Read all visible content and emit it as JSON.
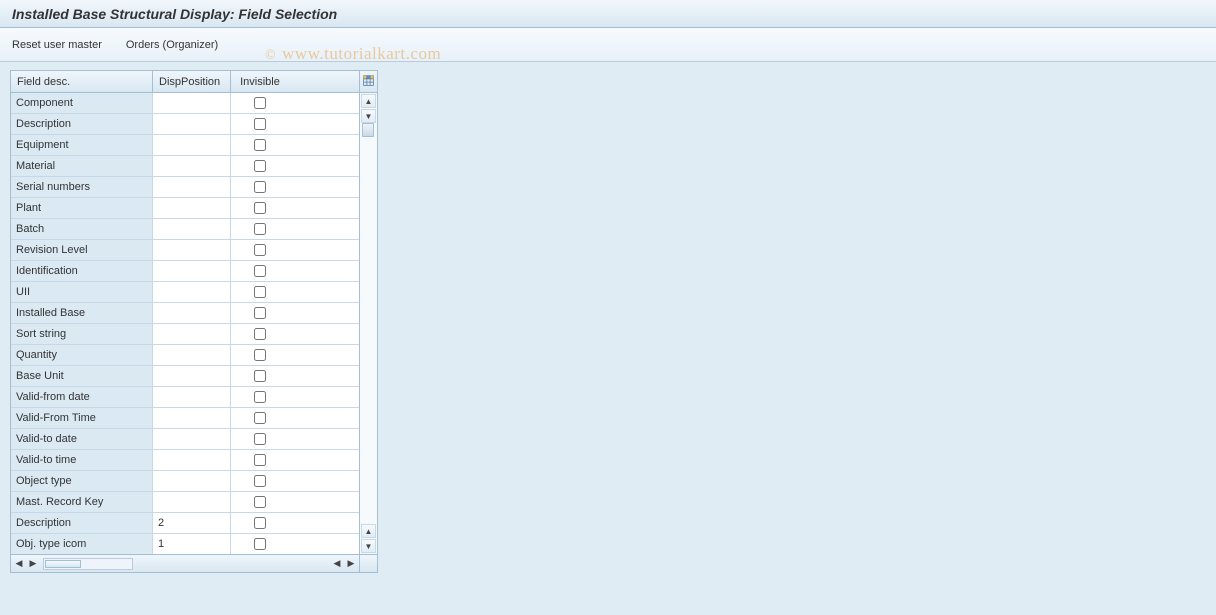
{
  "title": "Installed Base Structural Display: Field Selection",
  "toolbar": {
    "reset": "Reset user master",
    "orders": "Orders (Organizer)"
  },
  "watermark": "www.tutorialkart.com",
  "table": {
    "headers": {
      "desc": "Field desc.",
      "pos": "DispPosition",
      "inv": "Invisible"
    },
    "rows": [
      {
        "desc": "Component",
        "pos": "",
        "inv": false
      },
      {
        "desc": "Description",
        "pos": "",
        "inv": false
      },
      {
        "desc": "Equipment",
        "pos": "",
        "inv": false
      },
      {
        "desc": "Material",
        "pos": "",
        "inv": false
      },
      {
        "desc": "Serial numbers",
        "pos": "",
        "inv": false
      },
      {
        "desc": "Plant",
        "pos": "",
        "inv": false
      },
      {
        "desc": "Batch",
        "pos": "",
        "inv": false
      },
      {
        "desc": "Revision Level",
        "pos": "",
        "inv": false
      },
      {
        "desc": "Identification",
        "pos": "",
        "inv": false
      },
      {
        "desc": "UII",
        "pos": "",
        "inv": false
      },
      {
        "desc": "Installed Base",
        "pos": "",
        "inv": false
      },
      {
        "desc": "Sort string",
        "pos": "",
        "inv": false
      },
      {
        "desc": "Quantity",
        "pos": "",
        "inv": false
      },
      {
        "desc": "Base Unit",
        "pos": "",
        "inv": false
      },
      {
        "desc": "Valid-from date",
        "pos": "",
        "inv": false
      },
      {
        "desc": "Valid-From Time",
        "pos": "",
        "inv": false
      },
      {
        "desc": "Valid-to date",
        "pos": "",
        "inv": false
      },
      {
        "desc": "Valid-to time",
        "pos": "",
        "inv": false
      },
      {
        "desc": "Object type",
        "pos": "",
        "inv": false
      },
      {
        "desc": "Mast. Record Key",
        "pos": "",
        "inv": false
      },
      {
        "desc": "Description",
        "pos": "2",
        "inv": false
      },
      {
        "desc": "Obj. type icom",
        "pos": "1",
        "inv": false
      }
    ]
  }
}
